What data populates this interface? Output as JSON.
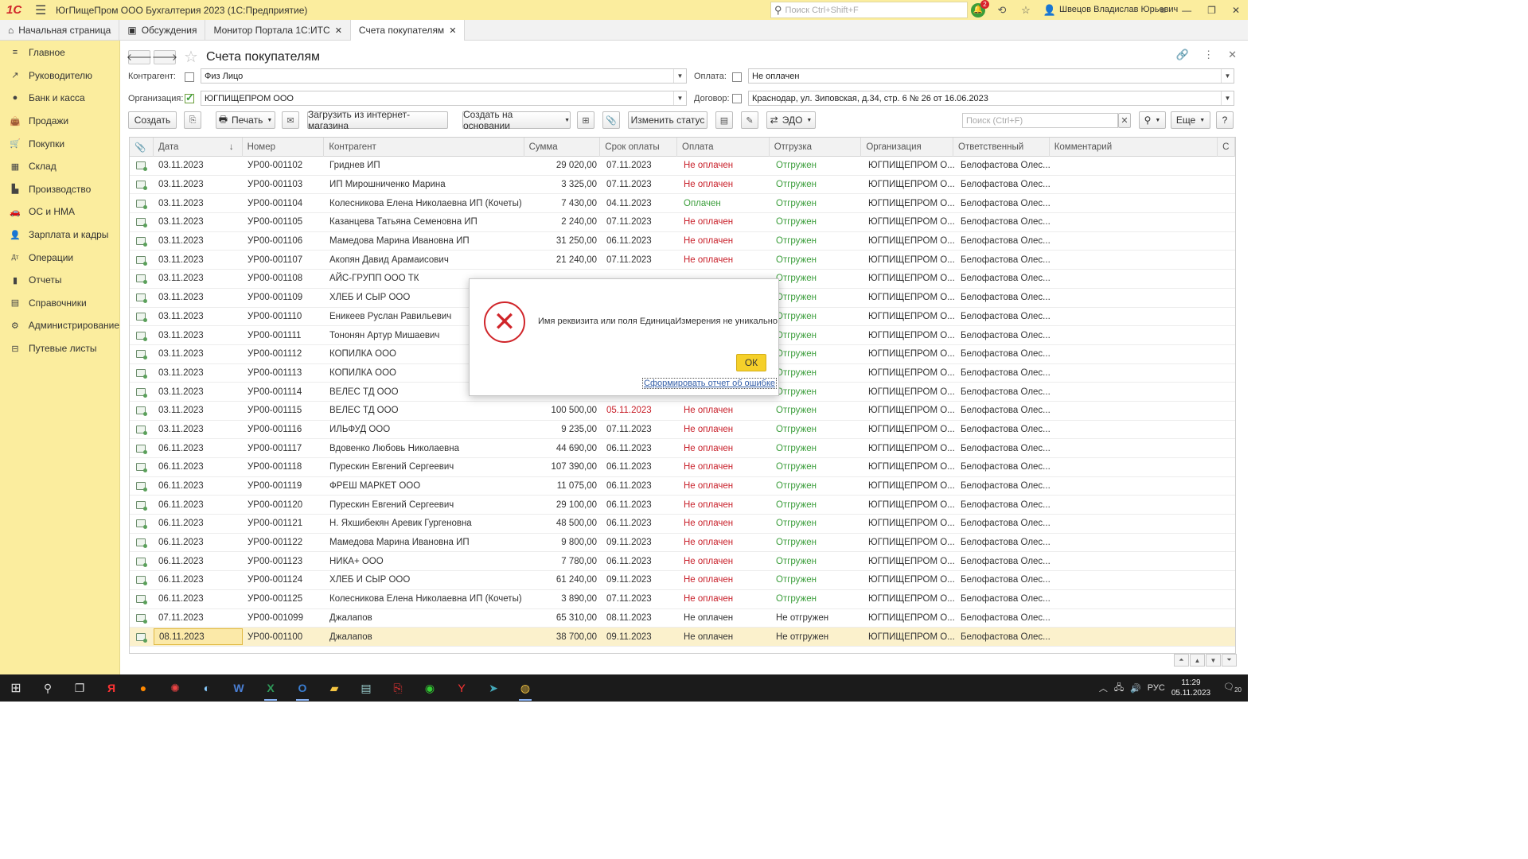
{
  "titlebar": {
    "app_title": "ЮгПищеПром ООО Бухгалтерия 2023  (1С:Предприятие)",
    "search_placeholder": "Поиск Ctrl+Shift+F",
    "notifications_count": "2",
    "user": "Швецов Владислав Юрьевич"
  },
  "tabs": [
    {
      "label": "Начальная страница"
    },
    {
      "label": "Обсуждения"
    },
    {
      "label": "Монитор Портала 1С:ИТС"
    },
    {
      "label": "Счета покупателям"
    }
  ],
  "sidebar": {
    "items": [
      {
        "label": "Главное",
        "icon": "menu-lines-icon"
      },
      {
        "label": "Руководителю",
        "icon": "trend-icon"
      },
      {
        "label": "Банк и касса",
        "icon": "coin-icon"
      },
      {
        "label": "Продажи",
        "icon": "bag-icon"
      },
      {
        "label": "Покупки",
        "icon": "cart-icon"
      },
      {
        "label": "Склад",
        "icon": "warehouse-icon"
      },
      {
        "label": "Производство",
        "icon": "factory-icon"
      },
      {
        "label": "ОС и НМА",
        "icon": "car-icon"
      },
      {
        "label": "Зарплата и кадры",
        "icon": "person-icon"
      },
      {
        "label": "Операции",
        "icon": "dt-kt-icon"
      },
      {
        "label": "Отчеты",
        "icon": "bar-chart-icon"
      },
      {
        "label": "Справочники",
        "icon": "book-icon"
      },
      {
        "label": "Администрирование",
        "icon": "gear-icon"
      },
      {
        "label": "Путевые листы",
        "icon": "waybill-icon"
      }
    ]
  },
  "form": {
    "title": "Счета покупателям",
    "kontragent_label": "Контрагент:",
    "kontragent_value": "Физ Лицо",
    "oplata_label": "Оплата:",
    "oplata_value": "Не оплачен",
    "organizacia_label": "Организация:",
    "organizacia_value": "ЮГПИЩЕПРОМ ООО",
    "dogovor_label": "Договор:",
    "dogovor_value": "Краснодар, ул. Зиповская, д.34, стр. 6 № 26 от 16.06.2023"
  },
  "toolbar": {
    "create": "Создать",
    "print": "Печать",
    "load": "Загрузить из интернет-магазина",
    "create_based": "Создать на основании",
    "change_status": "Изменить статус",
    "edo": "ЭДО",
    "search_placeholder": "Поиск (Ctrl+F)",
    "more": "Еще",
    "help": "?"
  },
  "table": {
    "columns": [
      "Дата",
      "Номер",
      "Контрагент",
      "Сумма",
      "Срок оплаты",
      "Оплата",
      "Отгрузка",
      "Организация",
      "Ответственный",
      "Комментарий",
      "С"
    ],
    "rows": [
      {
        "date": "03.11.2023",
        "num": "УР00-001102",
        "kontr": "Гриднев ИП",
        "sum": "29 020,00",
        "due": "07.11.2023",
        "pay": "Не оплачен",
        "ship": "Отгружен",
        "org": "ЮГПИЩЕПРОМ О...",
        "resp": "Белофастова Олес..."
      },
      {
        "date": "03.11.2023",
        "num": "УР00-001103",
        "kontr": "ИП Мирошниченко Марина",
        "sum": "3 325,00",
        "due": "07.11.2023",
        "pay": "Не оплачен",
        "ship": "Отгружен",
        "org": "ЮГПИЩЕПРОМ О...",
        "resp": "Белофастова Олес..."
      },
      {
        "date": "03.11.2023",
        "num": "УР00-001104",
        "kontr": "Колесникова Елена Николаевна ИП (Кочеты)",
        "sum": "7 430,00",
        "due": "04.11.2023",
        "pay": "Оплачен",
        "ship": "Отгружен",
        "org": "ЮГПИЩЕПРОМ О...",
        "resp": "Белофастова Олес..."
      },
      {
        "date": "03.11.2023",
        "num": "УР00-001105",
        "kontr": "Казанцева Татьяна Семеновна ИП",
        "sum": "2 240,00",
        "due": "07.11.2023",
        "pay": "Не оплачен",
        "ship": "Отгружен",
        "org": "ЮГПИЩЕПРОМ О...",
        "resp": "Белофастова Олес..."
      },
      {
        "date": "03.11.2023",
        "num": "УР00-001106",
        "kontr": "Мамедова Марина Ивановна ИП",
        "sum": "31 250,00",
        "due": "06.11.2023",
        "pay": "Не оплачен",
        "ship": "Отгружен",
        "org": "ЮГПИЩЕПРОМ О...",
        "resp": "Белофастова Олес..."
      },
      {
        "date": "03.11.2023",
        "num": "УР00-001107",
        "kontr": "Акопян Давид Арамаисович",
        "sum": "21 240,00",
        "due": "07.11.2023",
        "pay": "Не оплачен",
        "ship": "Отгружен",
        "org": "ЮГПИЩЕПРОМ О...",
        "resp": "Белофастова Олес..."
      },
      {
        "date": "03.11.2023",
        "num": "УР00-001108",
        "kontr": "АЙС-ГРУПП ООО ТК",
        "sum": "",
        "due": "",
        "pay": "",
        "ship": "Отгружен",
        "org": "ЮГПИЩЕПРОМ О...",
        "resp": "Белофастова Олес..."
      },
      {
        "date": "03.11.2023",
        "num": "УР00-001109",
        "kontr": "ХЛЕБ И СЫР ООО",
        "sum": "",
        "due": "",
        "pay": "",
        "ship": "Отгружен",
        "org": "ЮГПИЩЕПРОМ О...",
        "resp": "Белофастова Олес..."
      },
      {
        "date": "03.11.2023",
        "num": "УР00-001110",
        "kontr": "Еникеев Руслан Равильевич",
        "sum": "",
        "due": "",
        "pay": "",
        "ship": "Отгружен",
        "org": "ЮГПИЩЕПРОМ О...",
        "resp": "Белофастова Олес..."
      },
      {
        "date": "03.11.2023",
        "num": "УР00-001111",
        "kontr": "Тононян Артур Мишаевич",
        "sum": "",
        "due": "",
        "pay": "",
        "ship": "Отгружен",
        "org": "ЮГПИЩЕПРОМ О...",
        "resp": "Белофастова Олес..."
      },
      {
        "date": "03.11.2023",
        "num": "УР00-001112",
        "kontr": "КОПИЛКА ООО",
        "sum": "",
        "due": "",
        "pay": "",
        "ship": "Отгружен",
        "org": "ЮГПИЩЕПРОМ О...",
        "resp": "Белофастова Олес..."
      },
      {
        "date": "03.11.2023",
        "num": "УР00-001113",
        "kontr": "КОПИЛКА ООО",
        "sum": "",
        "due": "",
        "pay": "",
        "ship": "Отгружен",
        "org": "ЮГПИЩЕПРОМ О...",
        "resp": "Белофастова Олес..."
      },
      {
        "date": "03.11.2023",
        "num": "УР00-001114",
        "kontr": "ВЕЛЕС ТД ООО",
        "sum": "",
        "due": "",
        "pay": "",
        "ship": "Отгружен",
        "org": "ЮГПИЩЕПРОМ О...",
        "resp": "Белофастова Олес..."
      },
      {
        "date": "03.11.2023",
        "num": "УР00-001115",
        "kontr": "ВЕЛЕС ТД ООО",
        "sum": "100 500,00",
        "due": "05.11.2023",
        "dueRed": true,
        "pay": "Не оплачен",
        "ship": "Отгружен",
        "org": "ЮГПИЩЕПРОМ О...",
        "resp": "Белофастова Олес..."
      },
      {
        "date": "03.11.2023",
        "num": "УР00-001116",
        "kontr": "ИЛЬФУД ООО",
        "sum": "9 235,00",
        "due": "07.11.2023",
        "pay": "Не оплачен",
        "ship": "Отгружен",
        "org": "ЮГПИЩЕПРОМ О...",
        "resp": "Белофастова Олес..."
      },
      {
        "date": "06.11.2023",
        "num": "УР00-001117",
        "kontr": "Вдовенко Любовь Николаевна",
        "sum": "44 690,00",
        "due": "06.11.2023",
        "pay": "Не оплачен",
        "ship": "Отгружен",
        "org": "ЮГПИЩЕПРОМ О...",
        "resp": "Белофастова Олес..."
      },
      {
        "date": "06.11.2023",
        "num": "УР00-001118",
        "kontr": "Пурескин Евгений Сергеевич",
        "sum": "107 390,00",
        "due": "06.11.2023",
        "pay": "Не оплачен",
        "ship": "Отгружен",
        "org": "ЮГПИЩЕПРОМ О...",
        "resp": "Белофастова Олес..."
      },
      {
        "date": "06.11.2023",
        "num": "УР00-001119",
        "kontr": "ФРЕШ МАРКЕТ ООО",
        "sum": "11 075,00",
        "due": "06.11.2023",
        "pay": "Не оплачен",
        "ship": "Отгружен",
        "org": "ЮГПИЩЕПРОМ О...",
        "resp": "Белофастова Олес..."
      },
      {
        "date": "06.11.2023",
        "num": "УР00-001120",
        "kontr": "Пурескин Евгений Сергеевич",
        "sum": "29 100,00",
        "due": "06.11.2023",
        "pay": "Не оплачен",
        "ship": "Отгружен",
        "org": "ЮГПИЩЕПРОМ О...",
        "resp": "Белофастова Олес..."
      },
      {
        "date": "06.11.2023",
        "num": "УР00-001121",
        "kontr": "Н. Яхшибекян Аревик Гургеновна",
        "sum": "48 500,00",
        "due": "06.11.2023",
        "pay": "Не оплачен",
        "ship": "Отгружен",
        "org": "ЮГПИЩЕПРОМ О...",
        "resp": "Белофастова Олес..."
      },
      {
        "date": "06.11.2023",
        "num": "УР00-001122",
        "kontr": "Мамедова Марина Ивановна ИП",
        "sum": "9 800,00",
        "due": "09.11.2023",
        "pay": "Не оплачен",
        "ship": "Отгружен",
        "org": "ЮГПИЩЕПРОМ О...",
        "resp": "Белофастова Олес..."
      },
      {
        "date": "06.11.2023",
        "num": "УР00-001123",
        "kontr": "НИКА+ ООО",
        "sum": "7 780,00",
        "due": "06.11.2023",
        "pay": "Не оплачен",
        "ship": "Отгружен",
        "org": "ЮГПИЩЕПРОМ О...",
        "resp": "Белофастова Олес..."
      },
      {
        "date": "06.11.2023",
        "num": "УР00-001124",
        "kontr": "ХЛЕБ И СЫР ООО",
        "sum": "61 240,00",
        "due": "09.11.2023",
        "pay": "Не оплачен",
        "ship": "Отгружен",
        "org": "ЮГПИЩЕПРОМ О...",
        "resp": "Белофастова Олес..."
      },
      {
        "date": "06.11.2023",
        "num": "УР00-001125",
        "kontr": "Колесникова Елена Николаевна ИП (Кочеты)",
        "sum": "3 890,00",
        "due": "07.11.2023",
        "pay": "Не оплачен",
        "ship": "Отгружен",
        "org": "ЮГПИЩЕПРОМ О...",
        "resp": "Белофастова Олес..."
      },
      {
        "date": "07.11.2023",
        "num": "УР00-001099",
        "kontr": "Джалапов",
        "sum": "65 310,00",
        "due": "08.11.2023",
        "pay": "Не оплачен",
        "ship": "Не отгружен",
        "plain": true,
        "org": "ЮГПИЩЕПРОМ О...",
        "resp": "Белофастова Олес..."
      },
      {
        "date": "08.11.2023",
        "num": "УР00-001100",
        "kontr": "Джалапов",
        "sum": "38 700,00",
        "due": "09.11.2023",
        "pay": "Не оплачен",
        "ship": "Не отгружен",
        "plain": true,
        "selected": true,
        "org": "ЮГПИЩЕПРОМ О...",
        "resp": "Белофастова Олес..."
      }
    ]
  },
  "dialog": {
    "message": "Имя реквизита или поля ЕдиницаИзмерения не уникально",
    "ok": "ОК",
    "report_link": "Сформировать отчет об ошибке"
  },
  "taskbar": {
    "lang": "РУС",
    "time": "11:29",
    "date": "05.11.2023",
    "notif": "20"
  }
}
